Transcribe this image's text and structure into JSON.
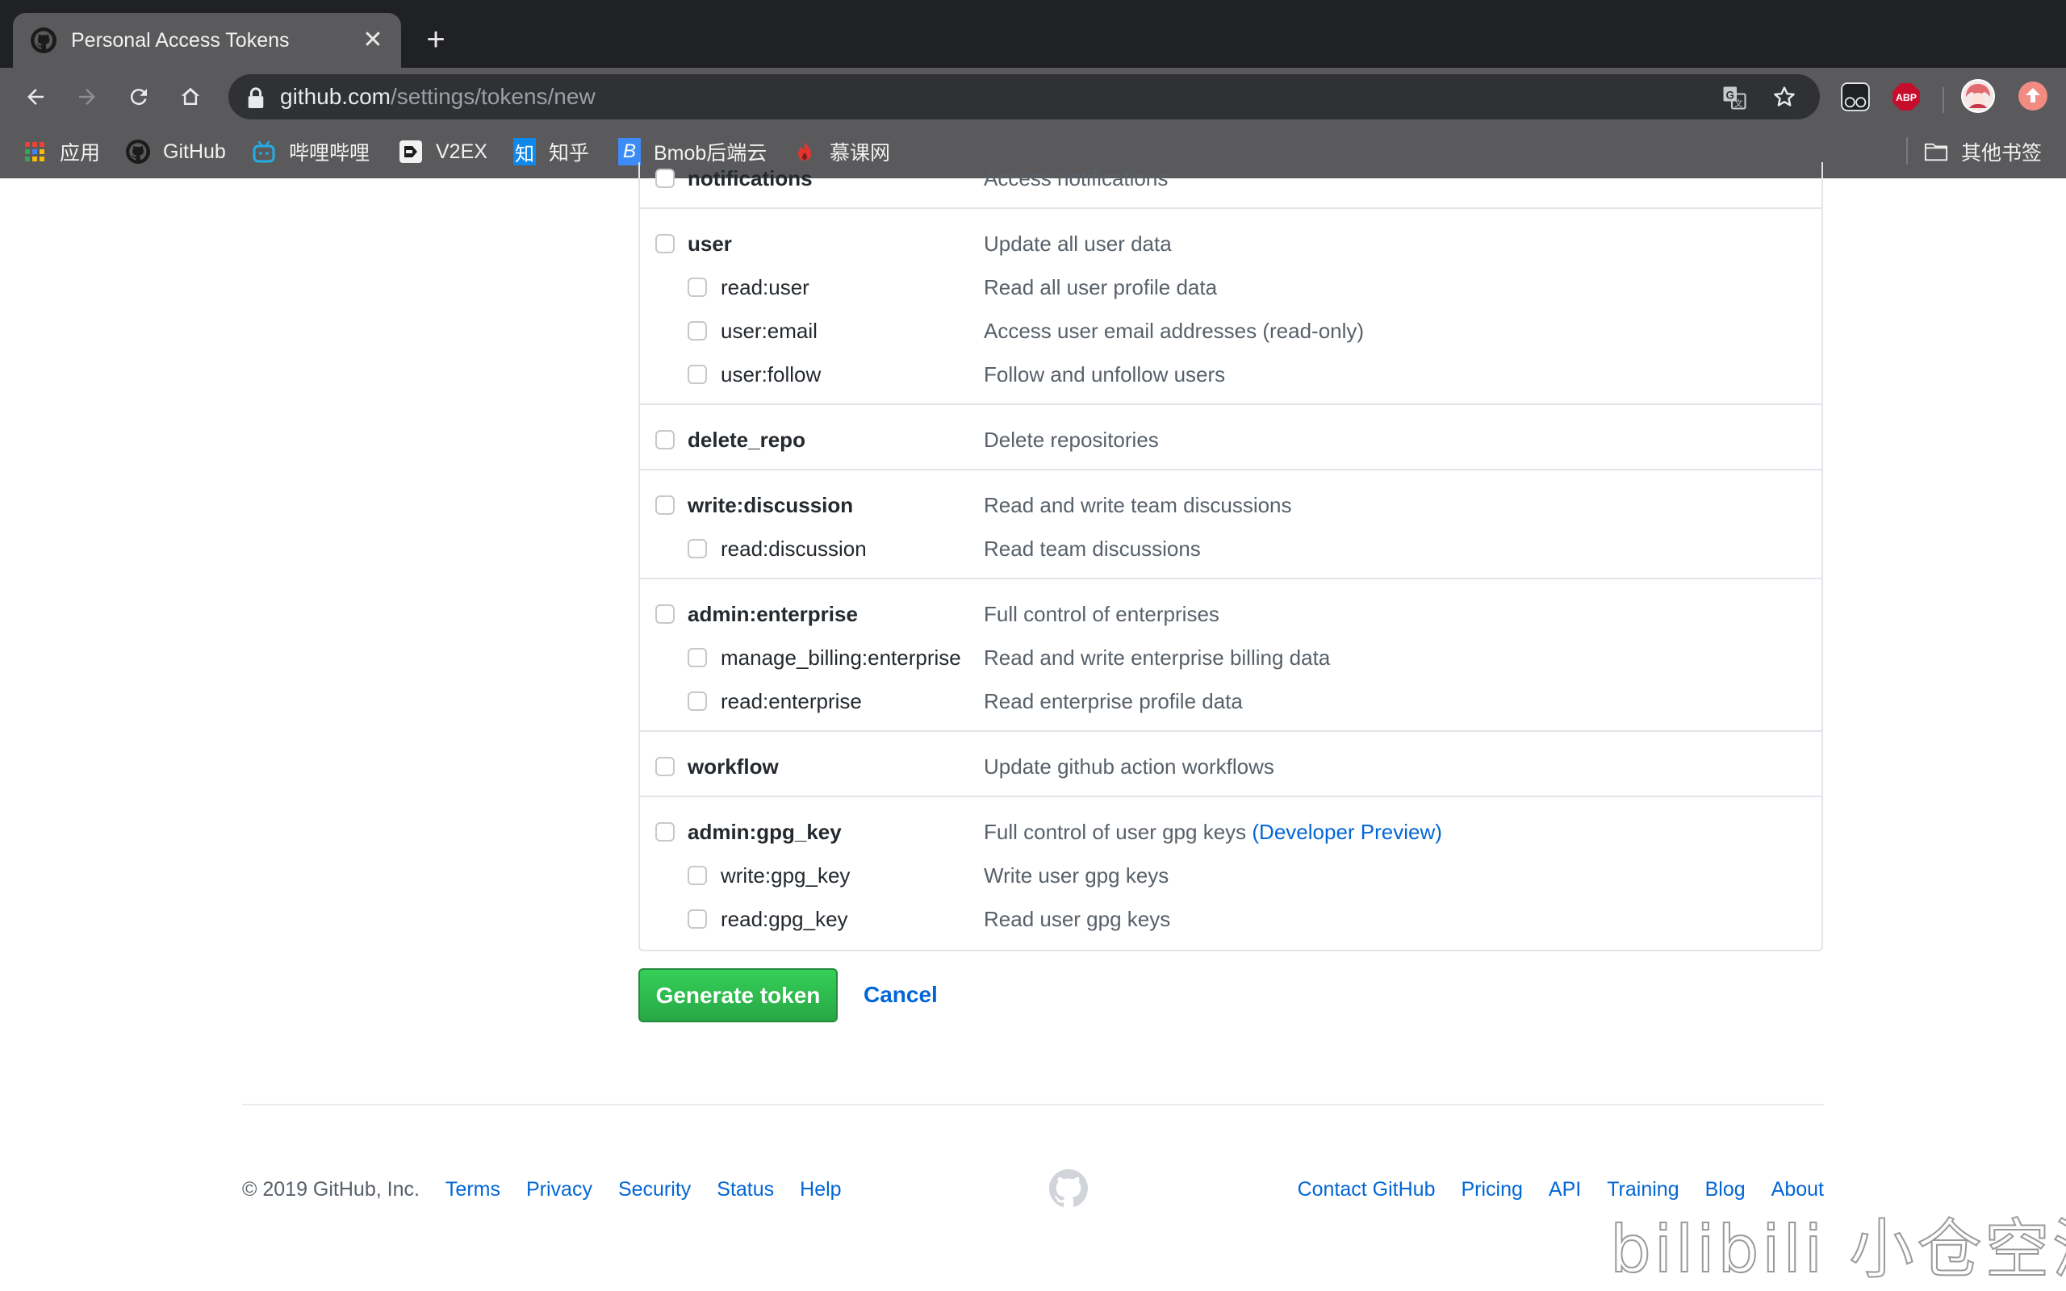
{
  "browser": {
    "tab_title": "Personal Access Tokens",
    "url_host": "github.com",
    "url_path": "/settings/tokens/new",
    "bookmarks": [
      {
        "label": "应用",
        "icon": "apps-grid-icon"
      },
      {
        "label": "GitHub",
        "icon": "github-icon"
      },
      {
        "label": "哔哩哔哩",
        "icon": "bilibili-icon"
      },
      {
        "label": "V2EX",
        "icon": "v2ex-icon"
      },
      {
        "label": "知乎",
        "icon": "zhihu-icon",
        "icon_text": "知"
      },
      {
        "label": "Bmob后端云",
        "icon": "bmob-icon",
        "icon_text": "B"
      },
      {
        "label": "慕课网",
        "icon": "imooc-flame-icon"
      }
    ],
    "other_bookmarks": "其他书签",
    "extensions": [
      {
        "name": "tampermonkey-icon"
      },
      {
        "name": "adblock-plus-icon",
        "text": "ABP"
      },
      {
        "name": "profile-avatar"
      },
      {
        "name": "update-arrow-icon"
      }
    ]
  },
  "scopes": {
    "groups": [
      {
        "items": [
          {
            "name": "notifications",
            "desc": "Access notifications",
            "level": "top",
            "checked": false
          }
        ]
      },
      {
        "items": [
          {
            "name": "user",
            "desc": "Update all user data",
            "level": "top",
            "checked": false
          },
          {
            "name": "read:user",
            "desc": "Read all user profile data",
            "level": "sub",
            "checked": false
          },
          {
            "name": "user:email",
            "desc": "Access user email addresses (read-only)",
            "level": "sub",
            "checked": false
          },
          {
            "name": "user:follow",
            "desc": "Follow and unfollow users",
            "level": "sub",
            "checked": false
          }
        ]
      },
      {
        "items": [
          {
            "name": "delete_repo",
            "desc": "Delete repositories",
            "level": "top",
            "checked": false
          }
        ]
      },
      {
        "items": [
          {
            "name": "write:discussion",
            "desc": "Read and write team discussions",
            "level": "top",
            "checked": false
          },
          {
            "name": "read:discussion",
            "desc": "Read team discussions",
            "level": "sub",
            "checked": false
          }
        ]
      },
      {
        "items": [
          {
            "name": "admin:enterprise",
            "desc": "Full control of enterprises",
            "level": "top",
            "checked": false
          },
          {
            "name": "manage_billing:enterprise",
            "desc": "Read and write enterprise billing data",
            "level": "sub",
            "checked": false
          },
          {
            "name": "read:enterprise",
            "desc": "Read enterprise profile data",
            "level": "sub",
            "checked": false
          }
        ]
      },
      {
        "items": [
          {
            "name": "workflow",
            "desc": "Update github action workflows",
            "level": "top",
            "checked": false
          }
        ]
      },
      {
        "items": [
          {
            "name": "admin:gpg_key",
            "desc": "Full control of user gpg keys",
            "desc_link": "(Developer Preview)",
            "level": "top",
            "checked": false
          },
          {
            "name": "write:gpg_key",
            "desc": "Write user gpg keys",
            "level": "sub",
            "checked": false
          },
          {
            "name": "read:gpg_key",
            "desc": "Read user gpg keys",
            "level": "sub",
            "checked": false
          }
        ]
      }
    ]
  },
  "actions": {
    "generate_label": "Generate token",
    "cancel_label": "Cancel"
  },
  "footer": {
    "copyright": "© 2019 GitHub, Inc.",
    "left_links": [
      "Terms",
      "Privacy",
      "Security",
      "Status",
      "Help"
    ],
    "right_links": [
      "Contact GitHub",
      "Pricing",
      "API",
      "Training",
      "Blog",
      "About"
    ]
  },
  "watermark": {
    "text": "bilibili 小仓空渚"
  },
  "colors": {
    "link": "#0366d6",
    "primary_button": "#28a745",
    "chrome_dark": "#202124",
    "chrome_toolbar": "#5a5a5c"
  }
}
